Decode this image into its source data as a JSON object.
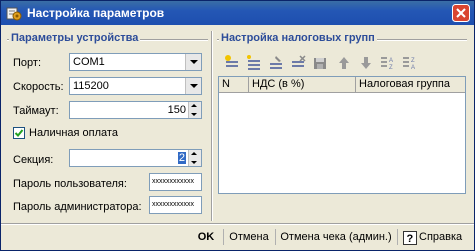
{
  "window": {
    "title": "Настройка параметров"
  },
  "device": {
    "group_title": "Параметры устройства",
    "port_label": "Порт:",
    "port_value": "COM1",
    "speed_label": "Скорость:",
    "speed_value": "115200",
    "timeout_label": "Таймаут:",
    "timeout_value": "150",
    "cash_payment_label": "Наличная оплата",
    "cash_payment_checked": true,
    "section_label": "Секция:",
    "section_value": "2",
    "user_password_label": "Пароль пользователя:",
    "user_password_value": "xxxxxxxxxxxx",
    "admin_password_label": "Пароль администратора:",
    "admin_password_value": "xxxxxxxxxxxx"
  },
  "tax": {
    "group_title": "Настройка налоговых групп",
    "columns": [
      "N",
      "НДС (в %)",
      "Налоговая группа"
    ],
    "toolbar_icons": [
      "add-row-icon",
      "copy-row-icon",
      "edit-row-icon",
      "delete-row-icon",
      "save-icon",
      "move-up-icon",
      "move-down-icon",
      "sort-asc-icon",
      "sort-desc-icon"
    ],
    "rows": []
  },
  "buttons": {
    "ok": "OK",
    "cancel": "Отмена",
    "cancel_receipt": "Отмена чека (админ.)",
    "help": "Справка"
  },
  "colors": {
    "title_bar": "#2457B5",
    "group_title": "#2D4D9A",
    "window_bg": "#ECE9D8"
  }
}
